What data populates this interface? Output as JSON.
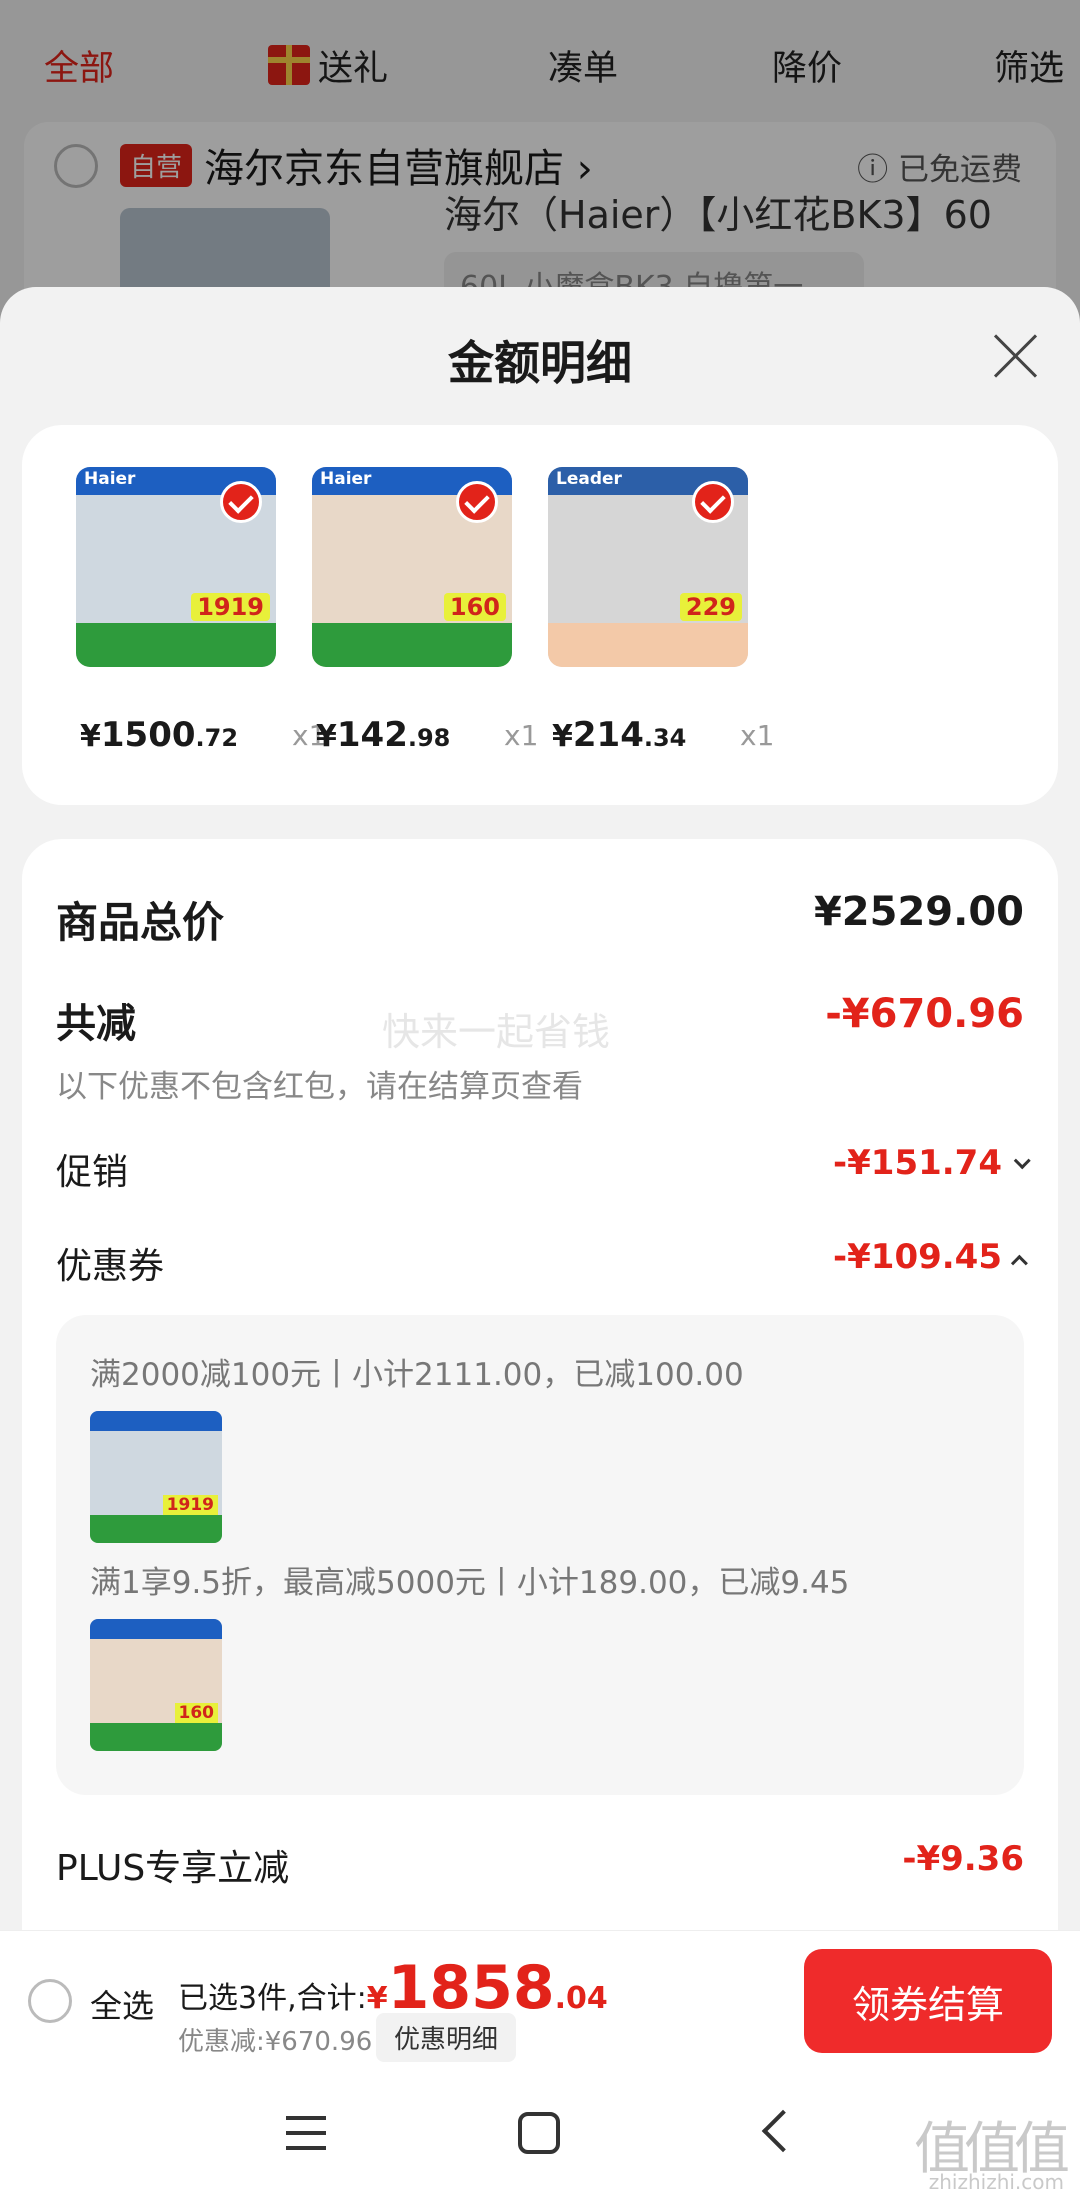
{
  "background": {
    "tabs": [
      "全部",
      "送礼",
      "凑单",
      "降价",
      "筛选"
    ],
    "shop_badge": "自营",
    "shop_name": "海尔京东自营旗舰店 ›",
    "shipping": "ⓘ 已免运费",
    "product_title": "海尔（Haier）【小红花BK3】60",
    "product_spec": "60L 小魔盒BK3 自撸第一 ⌄"
  },
  "sheet": {
    "title": "金额明细"
  },
  "products": [
    {
      "currency": "¥",
      "price_int": "1500",
      "price_dec": ".72",
      "qty": "x1",
      "thumb_logo": "Haier",
      "thumb_price": "1919"
    },
    {
      "currency": "¥",
      "price_int": "142",
      "price_dec": ".98",
      "qty": "x1",
      "thumb_logo": "Haier",
      "thumb_price": "160"
    },
    {
      "currency": "¥",
      "price_int": "214",
      "price_dec": ".34",
      "qty": "x1",
      "thumb_logo": "Leader",
      "thumb_price": "229"
    }
  ],
  "details": {
    "total_label": "商品总价",
    "total_value": "¥2529.00",
    "discount_label": "共减",
    "discount_value": "-¥670.96",
    "discount_note": "以下优惠不包含红包，请在结算页查看",
    "watermark": "快来一起省钱",
    "promo_label": "促销",
    "promo_value": "-¥151.74",
    "coupon_label": "优惠券",
    "coupon_value": "-¥109.45",
    "coupon_lines": [
      "满2000减100元丨小计2111.00，已减100.00",
      "满1享9.5折，最高减5000元丨小计189.00，已减9.45"
    ],
    "plus_label": "PLUS专享立减",
    "plus_value": "-¥9.36"
  },
  "bottom_bar": {
    "select_all": "全选",
    "summary_prefix": "已选3件,合计:",
    "currency": "¥",
    "total_int": "1858",
    "total_dec": ".04",
    "saving": "优惠减:¥670.96",
    "detail_button": "优惠明细",
    "checkout_button": "领券结算"
  },
  "branding": {
    "logo": "值值值",
    "url": "zhizhizhi.com"
  },
  "colors": {
    "accent_red": "#e2231a",
    "checkout_red": "#ef2b2b"
  }
}
